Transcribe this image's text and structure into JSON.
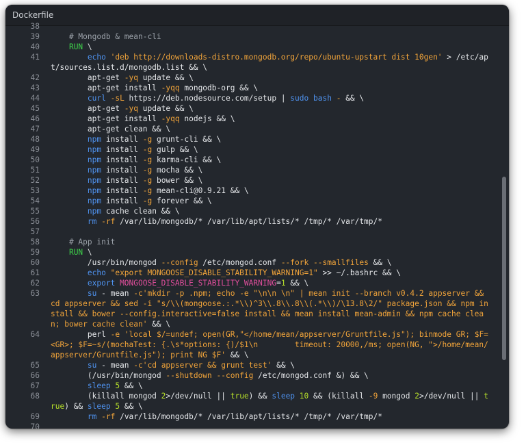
{
  "window": {
    "title": "Dockerfile"
  },
  "lines": [
    {
      "n": "38",
      "tokens": []
    },
    {
      "n": "39",
      "tokens": [
        {
          "t": "    "
        },
        {
          "t": "# Mongodb & mean-cli",
          "c": "c"
        }
      ]
    },
    {
      "n": "40",
      "tokens": [
        {
          "t": "    "
        },
        {
          "t": "RUN",
          "c": "k"
        },
        {
          "t": " \\"
        }
      ]
    },
    {
      "n": "41",
      "tokens": [
        {
          "t": "        "
        },
        {
          "t": "echo",
          "c": "b"
        },
        {
          "t": " "
        },
        {
          "t": "'deb http://downloads-distro.mongodb.org/repo/ubuntu-upstart dist 10gen'",
          "c": "s"
        },
        {
          "t": " > /etc/apt/sources.list.d/mongodb.list && \\"
        }
      ]
    },
    {
      "n": "42",
      "tokens": [
        {
          "t": "        apt-get "
        },
        {
          "t": "-yq",
          "c": "s"
        },
        {
          "t": " update && \\"
        }
      ]
    },
    {
      "n": "43",
      "tokens": [
        {
          "t": "        apt-get install "
        },
        {
          "t": "-yqq",
          "c": "s"
        },
        {
          "t": " mongodb-org && \\"
        }
      ]
    },
    {
      "n": "44",
      "tokens": [
        {
          "t": "        "
        },
        {
          "t": "curl",
          "c": "b"
        },
        {
          "t": " "
        },
        {
          "t": "-sL",
          "c": "s"
        },
        {
          "t": " https://deb.nodesource.com/setup | "
        },
        {
          "t": "sudo",
          "c": "b"
        },
        {
          "t": " "
        },
        {
          "t": "bash",
          "c": "b"
        },
        {
          "t": " "
        },
        {
          "t": "-",
          "c": "s"
        },
        {
          "t": " && \\"
        }
      ]
    },
    {
      "n": "45",
      "tokens": [
        {
          "t": "        apt-get "
        },
        {
          "t": "-yq",
          "c": "s"
        },
        {
          "t": " update && \\"
        }
      ]
    },
    {
      "n": "46",
      "tokens": [
        {
          "t": "        apt-get install "
        },
        {
          "t": "-yqq",
          "c": "s"
        },
        {
          "t": " nodejs && \\"
        }
      ]
    },
    {
      "n": "47",
      "tokens": [
        {
          "t": "        apt-get clean && \\"
        }
      ]
    },
    {
      "n": "48",
      "tokens": [
        {
          "t": "        "
        },
        {
          "t": "npm",
          "c": "b"
        },
        {
          "t": " install "
        },
        {
          "t": "-g",
          "c": "s"
        },
        {
          "t": " grunt-cli && \\"
        }
      ]
    },
    {
      "n": "49",
      "tokens": [
        {
          "t": "        "
        },
        {
          "t": "npm",
          "c": "b"
        },
        {
          "t": " install "
        },
        {
          "t": "-g",
          "c": "s"
        },
        {
          "t": " gulp && \\"
        }
      ]
    },
    {
      "n": "50",
      "tokens": [
        {
          "t": "        "
        },
        {
          "t": "npm",
          "c": "b"
        },
        {
          "t": " install "
        },
        {
          "t": "-g",
          "c": "s"
        },
        {
          "t": " karma-cli && \\"
        }
      ]
    },
    {
      "n": "51",
      "tokens": [
        {
          "t": "        "
        },
        {
          "t": "npm",
          "c": "b"
        },
        {
          "t": " install "
        },
        {
          "t": "-g",
          "c": "s"
        },
        {
          "t": " mocha && \\"
        }
      ]
    },
    {
      "n": "52",
      "tokens": [
        {
          "t": "        "
        },
        {
          "t": "npm",
          "c": "b"
        },
        {
          "t": " install "
        },
        {
          "t": "-g",
          "c": "s"
        },
        {
          "t": " bower && \\"
        }
      ]
    },
    {
      "n": "53",
      "tokens": [
        {
          "t": "        "
        },
        {
          "t": "npm",
          "c": "b"
        },
        {
          "t": " install "
        },
        {
          "t": "-g",
          "c": "s"
        },
        {
          "t": " mean-cli@0.9.21 && \\"
        }
      ]
    },
    {
      "n": "54",
      "tokens": [
        {
          "t": "        "
        },
        {
          "t": "npm",
          "c": "b"
        },
        {
          "t": " install "
        },
        {
          "t": "-g",
          "c": "s"
        },
        {
          "t": " forever && \\"
        }
      ]
    },
    {
      "n": "55",
      "tokens": [
        {
          "t": "        "
        },
        {
          "t": "npm",
          "c": "b"
        },
        {
          "t": " cache clean && \\"
        }
      ]
    },
    {
      "n": "56",
      "tokens": [
        {
          "t": "        "
        },
        {
          "t": "rm",
          "c": "b"
        },
        {
          "t": " "
        },
        {
          "t": "-rf",
          "c": "s"
        },
        {
          "t": " /var/lib/mongodb/* /var/lib/apt/lists/* /tmp/* /var/tmp/*"
        }
      ]
    },
    {
      "n": "57",
      "tokens": []
    },
    {
      "n": "58",
      "tokens": [
        {
          "t": "    "
        },
        {
          "t": "# App init",
          "c": "c"
        }
      ]
    },
    {
      "n": "59",
      "tokens": [
        {
          "t": "    "
        },
        {
          "t": "RUN",
          "c": "k"
        },
        {
          "t": " \\"
        }
      ]
    },
    {
      "n": "60",
      "tokens": [
        {
          "t": "        /usr/bin/mongod "
        },
        {
          "t": "--config",
          "c": "s"
        },
        {
          "t": " /etc/mongod.conf "
        },
        {
          "t": "--fork",
          "c": "s"
        },
        {
          "t": " "
        },
        {
          "t": "--smallfiles",
          "c": "s"
        },
        {
          "t": " && \\"
        }
      ]
    },
    {
      "n": "61",
      "tokens": [
        {
          "t": "        "
        },
        {
          "t": "echo",
          "c": "b"
        },
        {
          "t": " "
        },
        {
          "t": "\"export MONGOOSE_DISABLE_STABILITY_WARNING=1\"",
          "c": "s"
        },
        {
          "t": " >> ~/.bashrc && \\"
        }
      ]
    },
    {
      "n": "62",
      "tokens": [
        {
          "t": "        "
        },
        {
          "t": "export",
          "c": "b"
        },
        {
          "t": " "
        },
        {
          "t": "MONGOOSE_DISABLE_STABILITY_WARNING",
          "c": "v"
        },
        {
          "t": "="
        },
        {
          "t": "1",
          "c": "o"
        },
        {
          "t": " && \\"
        }
      ]
    },
    {
      "n": "63",
      "tokens": [
        {
          "t": "        "
        },
        {
          "t": "su",
          "c": "b"
        },
        {
          "t": " - mean "
        },
        {
          "t": "-c",
          "c": "s"
        },
        {
          "t": "'mkdir -p .npm; echo -e \"\\n\\n \\n\" | mean init --branch v0.4.2 appserver && cd appserver && sed -i \"s/\\\\(mongoose.:.*\\\\)^3\\\\.8\\\\.8\\\\(.*\\\\)/\\13.8\\2/\" package.json && npm install && bower --config.interactive=false install && mean install mean-admin && npm cache clean; bower cache clean'",
          "c": "s"
        },
        {
          "t": " && \\"
        }
      ]
    },
    {
      "n": "64",
      "tokens": [
        {
          "t": "        perl "
        },
        {
          "t": "-e",
          "c": "s"
        },
        {
          "t": " "
        },
        {
          "t": "'local $/=undef; open(GR,\"</home/mean/appserver/Gruntfile.js\"); binmode GR; $F=<GR>; $F=~s/(mochaTest: {.\\s*options: {)/$1\\n        timeout: 20000,/ms; open(NG, \">/home/mean/appserver/Gruntfile.js\"); print NG $F'",
          "c": "s"
        },
        {
          "t": " && \\"
        }
      ]
    },
    {
      "n": "65",
      "tokens": [
        {
          "t": "        "
        },
        {
          "t": "su",
          "c": "b"
        },
        {
          "t": " - mean "
        },
        {
          "t": "-c",
          "c": "s"
        },
        {
          "t": "'cd appserver && grunt test'",
          "c": "s"
        },
        {
          "t": " && \\"
        }
      ]
    },
    {
      "n": "66",
      "tokens": [
        {
          "t": "        (/usr/bin/mongod "
        },
        {
          "t": "--shutdown",
          "c": "s"
        },
        {
          "t": " "
        },
        {
          "t": "--config",
          "c": "s"
        },
        {
          "t": " /etc/mongod.conf &) && \\"
        }
      ]
    },
    {
      "n": "67",
      "tokens": [
        {
          "t": "        "
        },
        {
          "t": "sleep",
          "c": "b"
        },
        {
          "t": " "
        },
        {
          "t": "5",
          "c": "o"
        },
        {
          "t": " && \\"
        }
      ]
    },
    {
      "n": "68",
      "tokens": [
        {
          "t": "        (killall mongod "
        },
        {
          "t": "2",
          "c": "o"
        },
        {
          "t": ">/dev/null || "
        },
        {
          "t": "true",
          "c": "o"
        },
        {
          "t": ") && "
        },
        {
          "t": "sleep",
          "c": "b"
        },
        {
          "t": " "
        },
        {
          "t": "10",
          "c": "o"
        },
        {
          "t": " && (killall "
        },
        {
          "t": "-9",
          "c": "s"
        },
        {
          "t": " mongod "
        },
        {
          "t": "2",
          "c": "o"
        },
        {
          "t": ">/dev/null || "
        },
        {
          "t": "true",
          "c": "o"
        },
        {
          "t": ") && "
        },
        {
          "t": "sleep",
          "c": "b"
        },
        {
          "t": " "
        },
        {
          "t": "5",
          "c": "o"
        },
        {
          "t": " && \\"
        }
      ]
    },
    {
      "n": "69",
      "tokens": [
        {
          "t": "        "
        },
        {
          "t": "rm",
          "c": "b"
        },
        {
          "t": " "
        },
        {
          "t": "-rf",
          "c": "s"
        },
        {
          "t": " /var/lib/mongodb/* /var/lib/apt/lists/* /tmp/* /var/tmp/*"
        }
      ]
    },
    {
      "n": "70",
      "tokens": []
    }
  ]
}
